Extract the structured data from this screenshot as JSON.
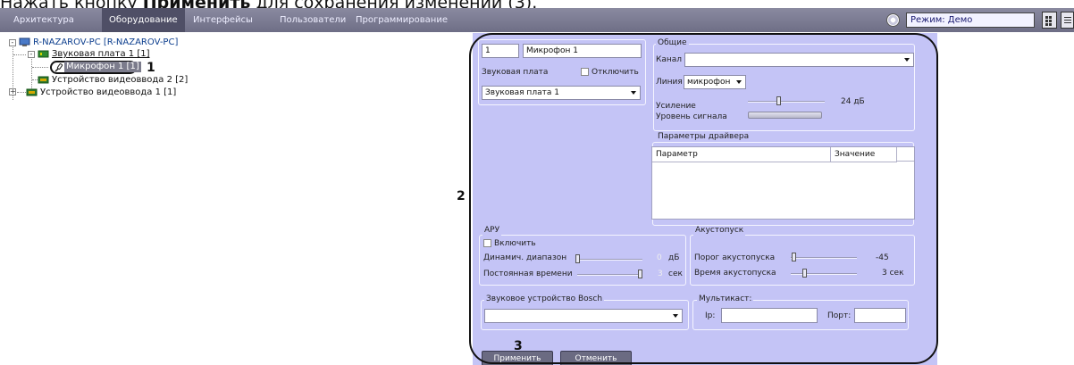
{
  "caption": {
    "prefix": "Нажать кнопку ",
    "bold": "Применить",
    "suffix": " для сохранения изменений (3)."
  },
  "topbar": {
    "tabs": [
      "Архитектура",
      "Оборудование",
      "Интерфейсы",
      "Пользователи",
      "Программирование"
    ],
    "active_tab": "Оборудование",
    "mode_value": "Режим: Демо"
  },
  "tree": {
    "root": "R-NAZAROV-PC [R-NAZAROV-PC]",
    "sound_card": "Звуковая плата 1 [1]",
    "microphone": "Микрофон 1 [1]",
    "video_2": "Устройство видеоввода 2 [2]",
    "video_1": "Устройство видеоввода 1 [1]"
  },
  "markers": {
    "m1": "1",
    "m2": "2",
    "m3": "3"
  },
  "settings": {
    "id_value": "1",
    "name_value": "Микрофон 1",
    "sound_card_label": "Звуковая плата",
    "disable_label": "Отключить",
    "sound_card_value": "Звуковая плата 1",
    "general": {
      "title": "Общие",
      "channel_label": "Канал",
      "channel_value": "",
      "line_label": "Линия",
      "line_value": "микрофон",
      "gain_label": "Усиление",
      "gain_value": "24 дБ",
      "gain_level": 0.4,
      "signal_label": "Уровень сигнала"
    },
    "driver": {
      "title": "Параметры драйвера",
      "col_param": "Параметр",
      "col_value": "Значение"
    },
    "agc": {
      "title": "АРУ",
      "enable_label": "Включить",
      "range_label": "Динамич. диапазон",
      "range_value": "0",
      "range_unit": "дБ",
      "time_label": "Постоянная времени",
      "time_value": "3",
      "time_unit": "сек"
    },
    "vox": {
      "title": "Акустопуск",
      "threshold_label": "Порог акустопуска",
      "threshold_value": "-45",
      "time_label": "Время акустопуска",
      "time_value": "3 сек"
    },
    "bosch": {
      "title": "Звуковое устройство Bosch",
      "value": ""
    },
    "multicast": {
      "title": "Мультикаст:",
      "ip_label": "Ip:",
      "port_label": "Порт:",
      "ip_value": "",
      "port_value": ""
    },
    "apply_label": "Применить",
    "cancel_label": "Отменить"
  }
}
